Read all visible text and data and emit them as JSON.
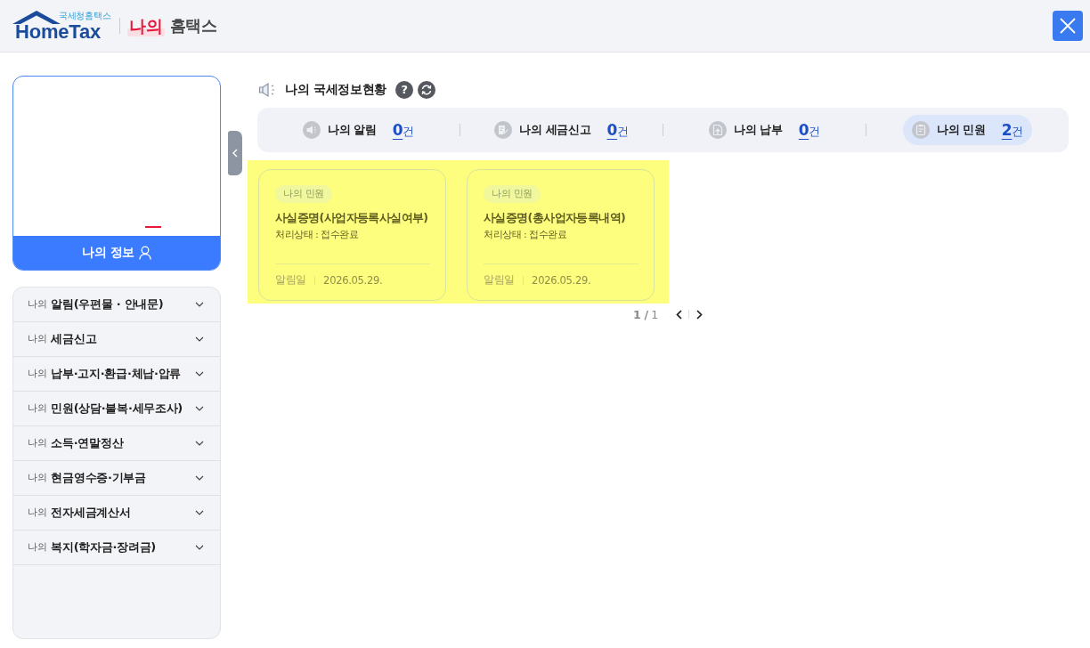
{
  "header": {
    "logo": {
      "subtitle": "국세청홈택스",
      "name": "HomeTax"
    },
    "service": {
      "highlight": "나의",
      "name": "홈택스"
    }
  },
  "profile": {
    "button": "나의 정보"
  },
  "menu": {
    "items": [
      {
        "prefix": "나의",
        "label": "알림(우편물 · 안내문)",
        "expanded": false
      },
      {
        "prefix": "나의",
        "label": "세금신고",
        "expanded": false
      },
      {
        "prefix": "나의",
        "label": "납부·고지·환급·체납·압류",
        "expanded": false
      },
      {
        "prefix": "나의",
        "label": "민원(상담·불복·세무조사)",
        "expanded": false
      },
      {
        "prefix": "나의",
        "label": "소득·연말정산",
        "expanded": false
      },
      {
        "prefix": "나의",
        "label": "현금영수증·기부금",
        "expanded": false
      },
      {
        "prefix": "나의",
        "label": "전자세금계산서",
        "expanded": false
      },
      {
        "prefix": "나의",
        "label": "복지(학자금·장려금)",
        "expanded": false
      }
    ]
  },
  "status": {
    "title": "나의 국세정보현황",
    "help": "?",
    "summary": [
      {
        "kind": "notice",
        "label": "나의 알림",
        "count": "0",
        "unit": "건",
        "selected": false
      },
      {
        "kind": "filing",
        "label": "나의 세금신고",
        "count": "0",
        "unit": "건",
        "selected": false
      },
      {
        "kind": "payment",
        "label": "나의 납부",
        "count": "0",
        "unit": "건",
        "selected": false
      },
      {
        "kind": "petition",
        "label": "나의 민원",
        "count": "2",
        "unit": "건",
        "selected": true
      }
    ]
  },
  "results": {
    "highlighted": true,
    "cards": [
      {
        "tag": "나의 민원",
        "title": "사실증명(사업자등록사실여부)",
        "status": "처리상태 : 접수완료",
        "date_label": "알림일",
        "date": "2026.05.29."
      },
      {
        "tag": "나의 민원",
        "title": "사실증명(총사업자등록내역)",
        "status": "처리상태 : 접수완료",
        "date_label": "알림일",
        "date": "2026.05.29."
      }
    ]
  },
  "pagination": {
    "page": "**1 /** 1"
  }
}
